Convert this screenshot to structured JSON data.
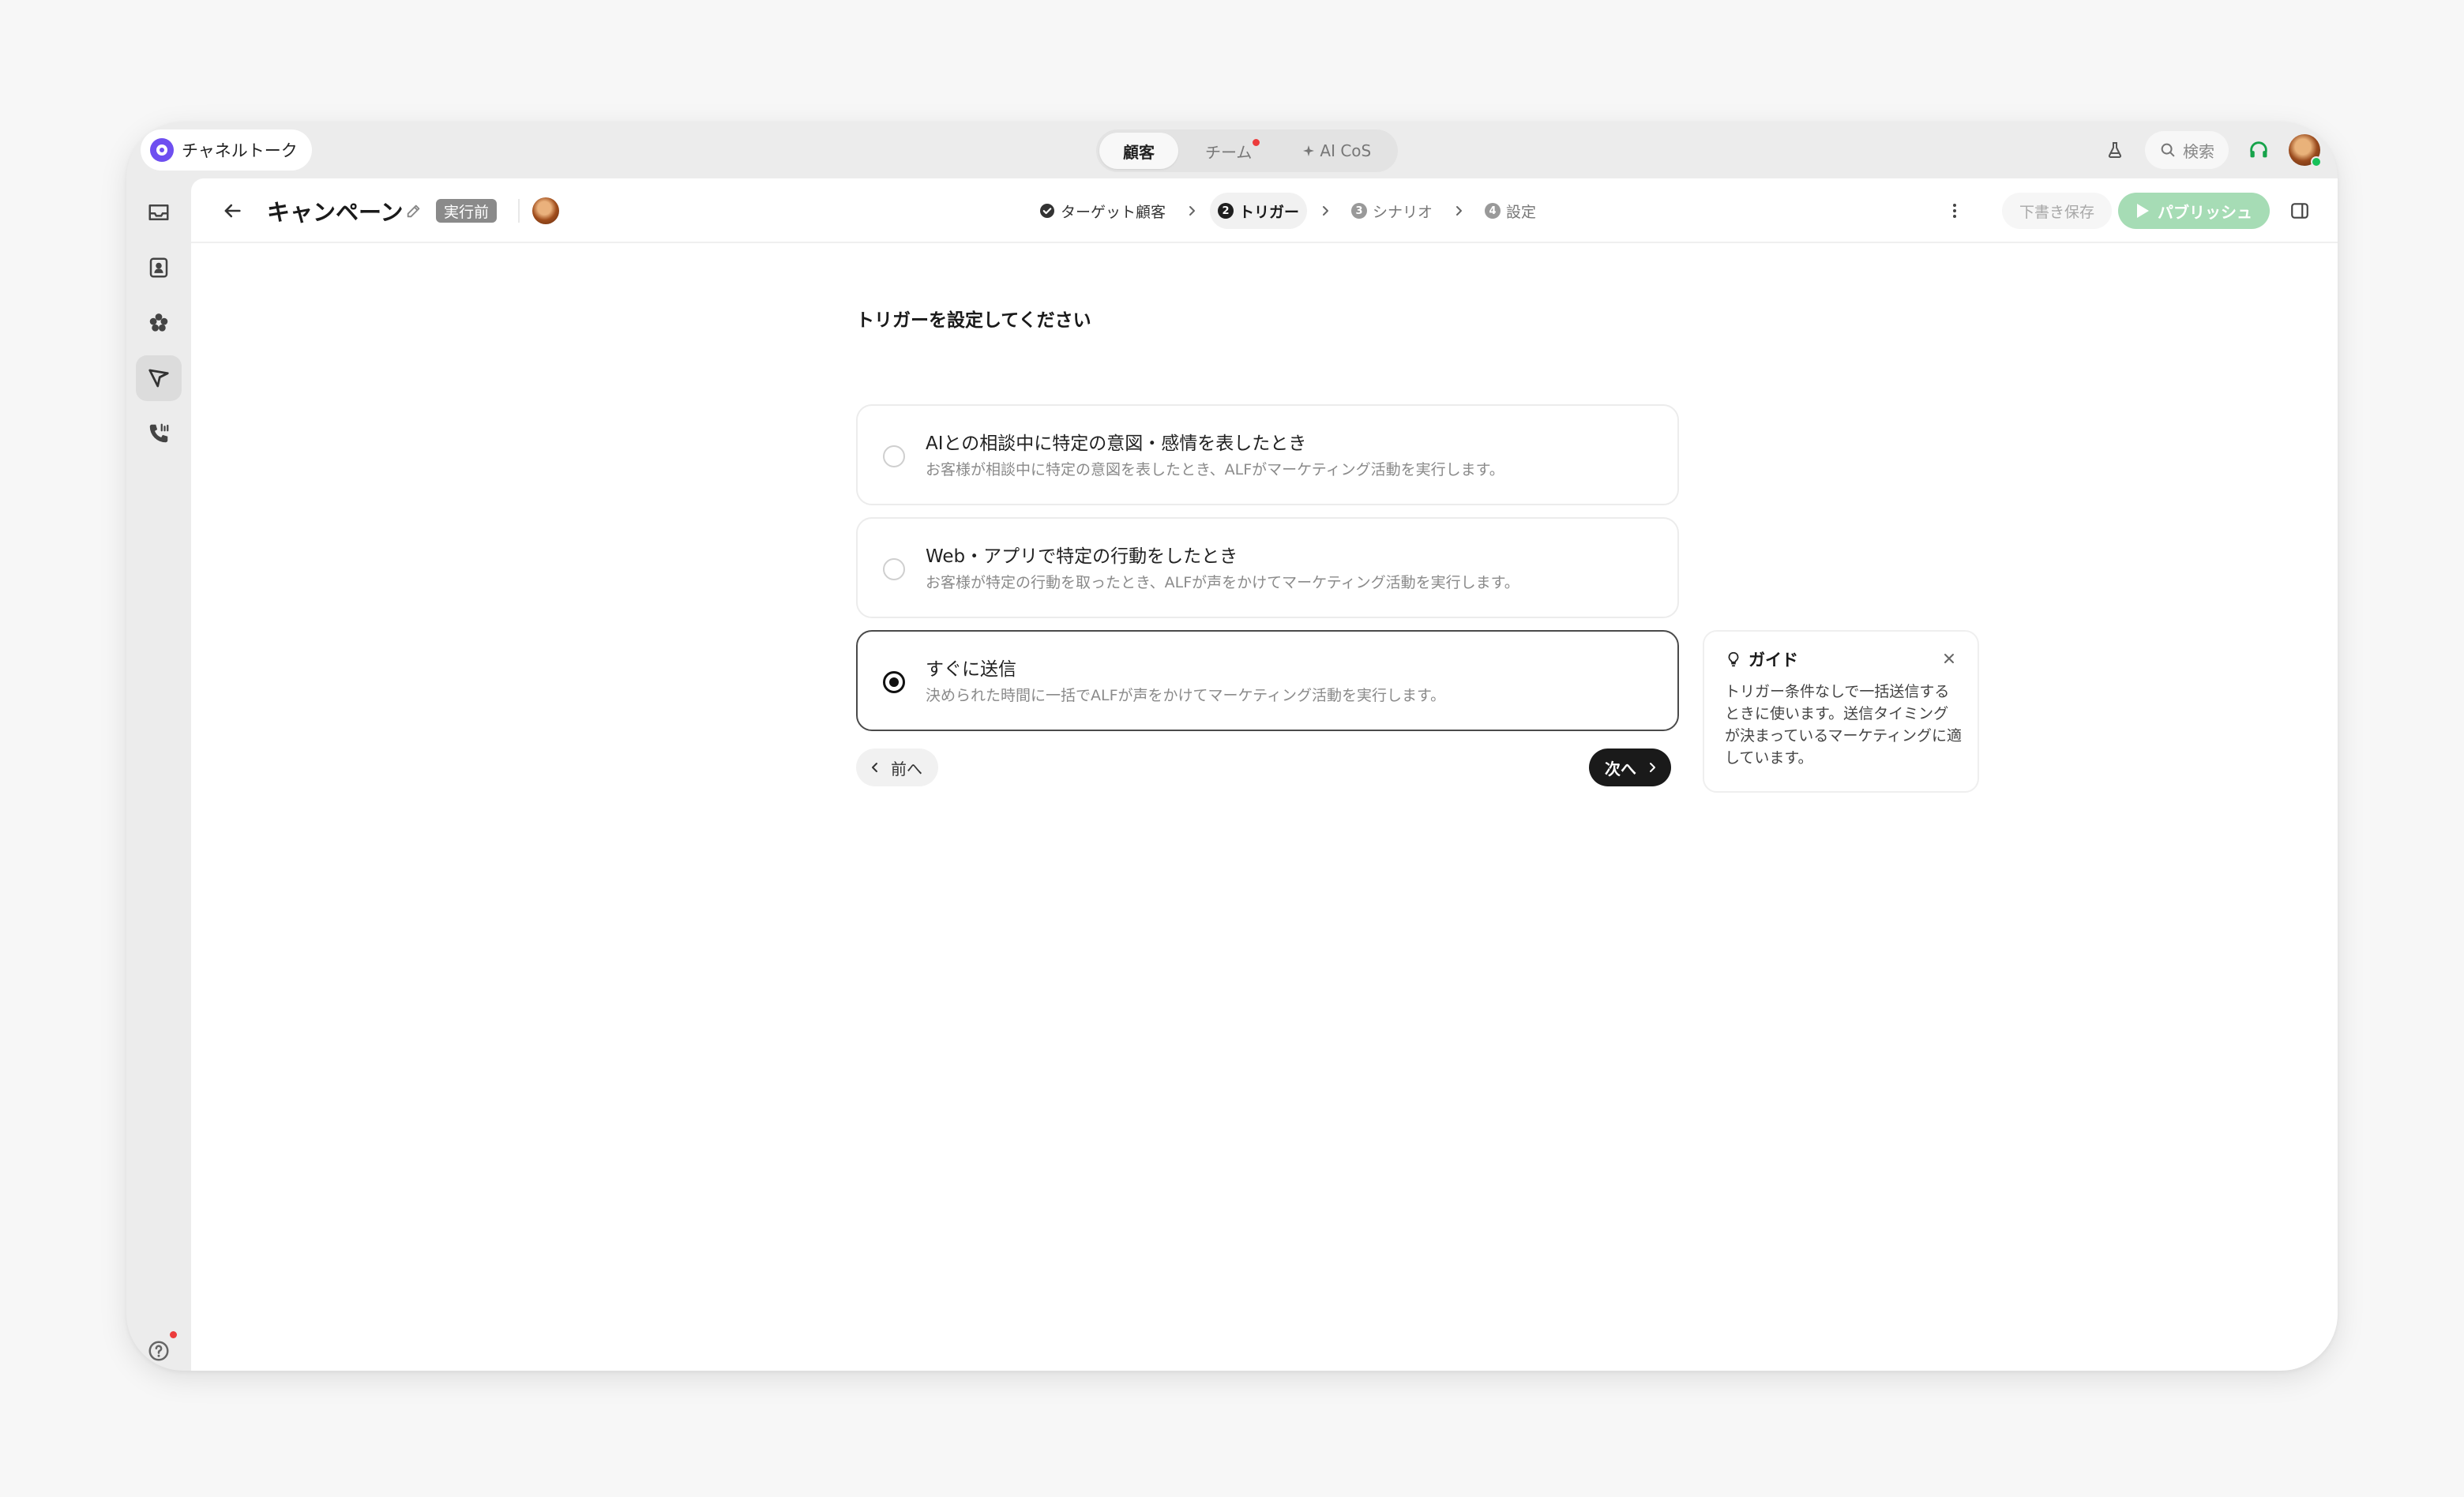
{
  "app": {
    "name": "チャネルトーク"
  },
  "top_tabs": [
    {
      "label": "顧客",
      "active": true
    },
    {
      "label": "チーム",
      "active": false,
      "notification": true
    },
    {
      "label": "AI CoS",
      "active": false
    }
  ],
  "top_right": {
    "search_label": "検索"
  },
  "sidebar": {
    "items": [
      {
        "icon": "inbox-icon",
        "active": false
      },
      {
        "icon": "contacts-icon",
        "active": false
      },
      {
        "icon": "apps-icon",
        "active": false
      },
      {
        "icon": "campaign-icon",
        "active": true
      },
      {
        "icon": "phone-icon",
        "active": false
      }
    ],
    "bottom": [
      {
        "icon": "help-icon",
        "notification": true
      },
      {
        "icon": "gear-icon"
      }
    ]
  },
  "header": {
    "title": "キャンペーン",
    "status": "実行前",
    "steps": [
      {
        "number": "1",
        "label": "ターゲット顧客",
        "state": "done"
      },
      {
        "number": "2",
        "label": "トリガー",
        "state": "current"
      },
      {
        "number": "3",
        "label": "シナリオ",
        "state": "upcoming"
      },
      {
        "number": "4",
        "label": "設定",
        "state": "upcoming"
      }
    ],
    "draft_label": "下書き保存",
    "publish_label": "パブリッシュ"
  },
  "form": {
    "title": "トリガーを設定してください",
    "options": [
      {
        "title": "AIとの相談中に特定の意図・感情を表したとき",
        "description": "お客様が相談中に特定の意図を表したとき、ALFがマーケティング活動を実行します。",
        "selected": false
      },
      {
        "title": "Web・アプリで特定の行動をしたとき",
        "description": "お客様が特定の行動を取ったとき、ALFが声をかけてマーケティング活動を実行します。",
        "selected": false
      },
      {
        "title": "すぐに送信",
        "description": "決められた時間に一括でALFが声をかけてマーケティング活動を実行します。",
        "selected": true
      }
    ],
    "prev_label": "前へ",
    "next_label": "次へ"
  },
  "guide": {
    "title": "ガイド",
    "body": "トリガー条件なしで一括送信するときに使います。送信タイミングが決まっているマーケティングに適しています。"
  },
  "colors": {
    "brand": "#6e4ff0",
    "publish": "#a6dcb5",
    "online": "#17c15a",
    "notification": "#ec3c3c",
    "support_icon": "#16a34a"
  }
}
